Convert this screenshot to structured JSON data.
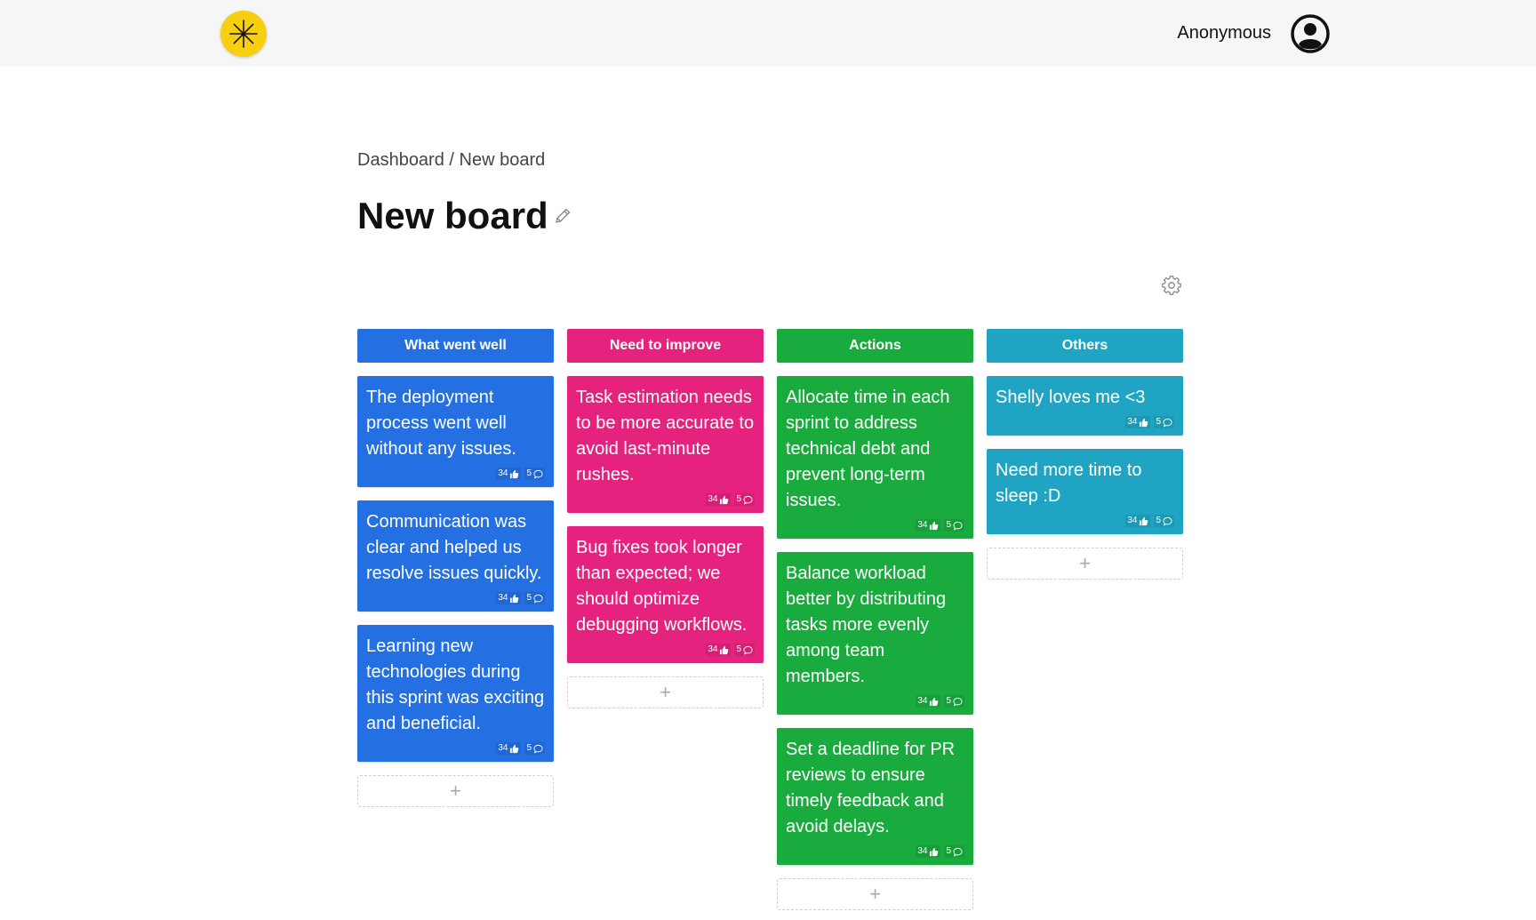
{
  "header": {
    "logo_icon": "asterisk-logo-icon",
    "user_name": "Anonymous",
    "avatar_icon": "user-circle-icon"
  },
  "breadcrumb": {
    "root": "Dashboard",
    "separator": " / ",
    "current": "New board"
  },
  "page": {
    "title": "New board",
    "edit_icon": "pencil-icon",
    "settings_icon": "gear-icon"
  },
  "colors": {
    "went_well": "#2470e3",
    "improve": "#e5237f",
    "actions": "#1aab3e",
    "others": "#1fa5c3",
    "logo": "#f7cf0f"
  },
  "add_label": "+",
  "columns": [
    {
      "title": "What went well",
      "color": "#2470e3",
      "cards": [
        {
          "text": "The deployment process went well without any issues.",
          "likes": "34",
          "comments": "5"
        },
        {
          "text": "Communication was clear and helped us resolve issues quickly.",
          "likes": "34",
          "comments": "5"
        },
        {
          "text": "Learning new technologies during this sprint was exciting and beneficial.",
          "likes": "34",
          "comments": "5"
        }
      ]
    },
    {
      "title": "Need to improve",
      "color": "#e5237f",
      "cards": [
        {
          "text": "Task estimation needs to be more accurate to avoid last-minute rushes.",
          "likes": "34",
          "comments": "5"
        },
        {
          "text": "Bug fixes took longer than expected; we should optimize debugging workflows.",
          "likes": "34",
          "comments": "5"
        }
      ]
    },
    {
      "title": "Actions",
      "color": "#1aab3e",
      "cards": [
        {
          "text": "Allocate time in each sprint to address technical debt and prevent long-term issues.",
          "likes": "34",
          "comments": "5"
        },
        {
          "text": "Balance workload better by distributing tasks more evenly among team members.",
          "likes": "34",
          "comments": "5"
        },
        {
          "text": "Set a deadline for PR reviews to ensure timely feedback and avoid delays.",
          "likes": "34",
          "comments": "5"
        }
      ]
    },
    {
      "title": "Others",
      "color": "#1fa5c3",
      "cards": [
        {
          "text": "Shelly loves me <3",
          "likes": "34",
          "comments": "5"
        },
        {
          "text": "Need more time to sleep :D",
          "likes": "34",
          "comments": "5"
        }
      ]
    }
  ]
}
